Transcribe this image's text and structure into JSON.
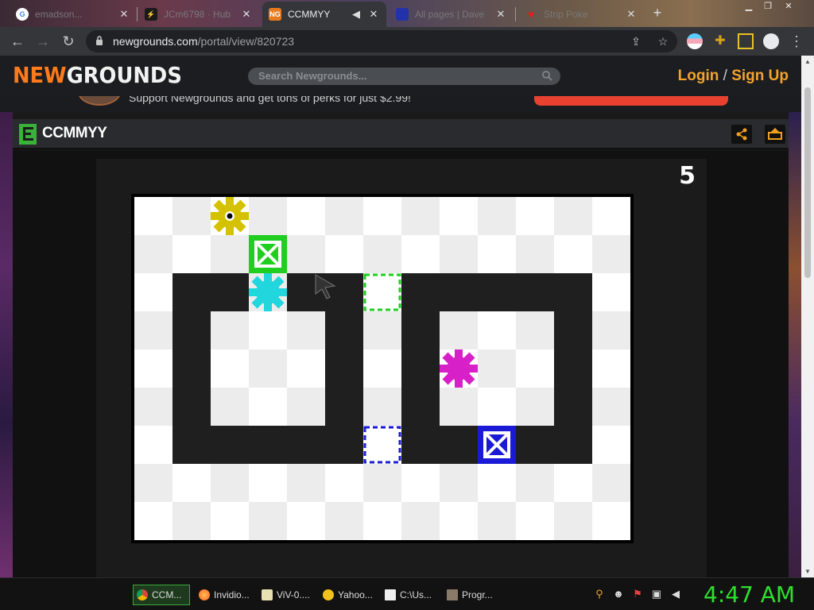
{
  "browser": {
    "tabs": [
      {
        "title": "emadson...",
        "active": false
      },
      {
        "title": "JCm6798 · Hub",
        "active": false
      },
      {
        "title": "CCMMYY",
        "active": true
      },
      {
        "title": "All pages | Dave",
        "active": false
      },
      {
        "title": "Strip Poke",
        "active": false
      }
    ],
    "new_tab_glyph": "+",
    "url_host": "newgrounds.com",
    "url_path": "/portal/view/820723"
  },
  "site": {
    "logo_new": "NEW",
    "logo_grounds": "GROUNDS",
    "search_placeholder": "Search Newgrounds...",
    "login_label": "Login",
    "login_sep": " / ",
    "signup_label": "Sign Up",
    "promo_text": "Support Newgrounds and get tons of perks for just $2.99!"
  },
  "game": {
    "title": "CCMMYY",
    "level": "5",
    "colors": {
      "yellow": "#d4c200",
      "green": "#1fce1f",
      "cyan": "#22d6dd",
      "magenta": "#d820c8",
      "blue": "#1a1ad6",
      "wall": "#1f1f1f",
      "light": "#ffffff",
      "dark": "#ececec"
    }
  },
  "taskbar": {
    "items": [
      {
        "label": "CCM...",
        "icon": "chrome-icon",
        "active": true
      },
      {
        "label": "Invidio...",
        "icon": "firefox-icon",
        "active": false
      },
      {
        "label": "ViV-0....",
        "icon": "document-icon",
        "active": false
      },
      {
        "label": "Yahoo...",
        "icon": "yahoo-icon",
        "active": false
      },
      {
        "label": "C:\\Us...",
        "icon": "7zip-icon",
        "active": false
      },
      {
        "label": "Progr...",
        "icon": "program-icon",
        "active": false
      }
    ],
    "clock": "4:47 AM"
  }
}
